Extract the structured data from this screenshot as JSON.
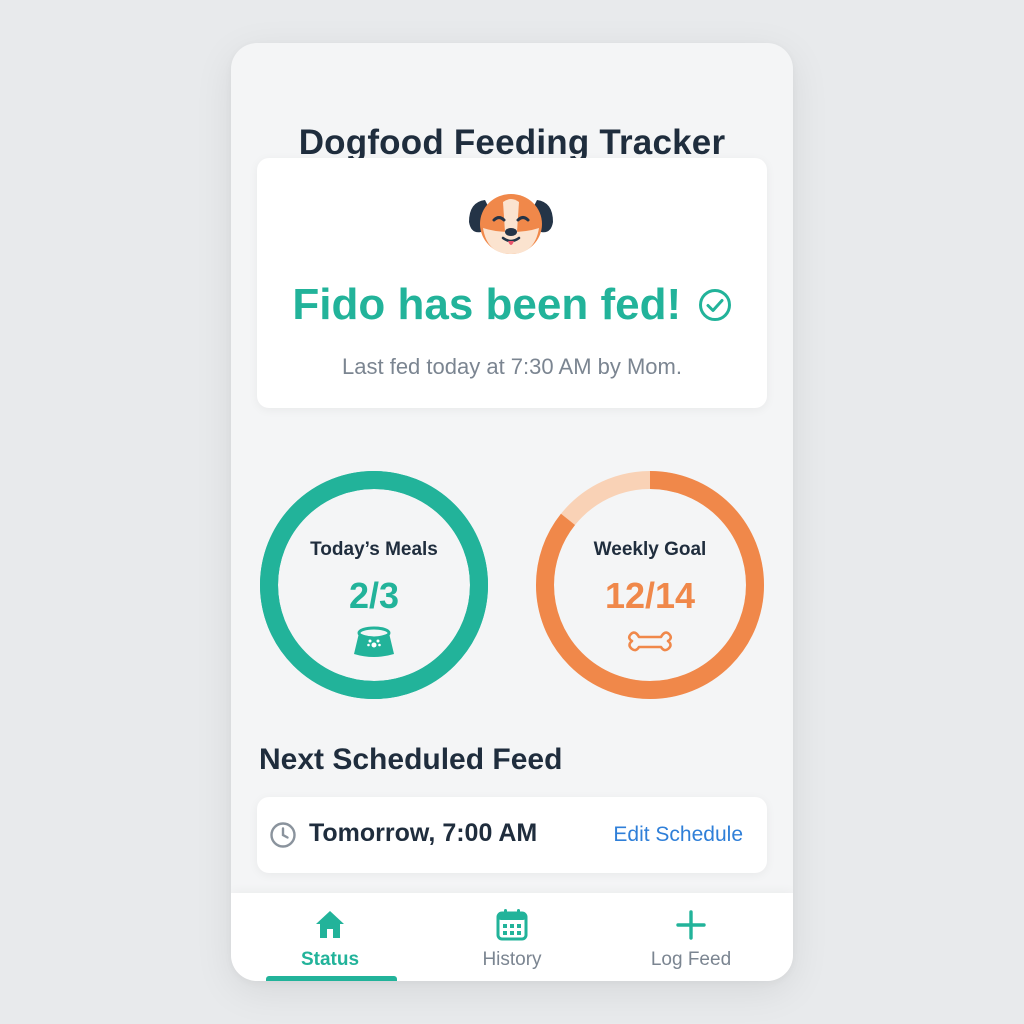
{
  "app": {
    "title": "Dogfood Feeding Tracker"
  },
  "status_card": {
    "avatar_icon": "dog-face-icon",
    "message": "Fido has been fed!",
    "status_icon": "check-circle-icon",
    "last_fed": "Last fed today at 7:30 AM by Mom."
  },
  "progress": {
    "meals": {
      "label": "Today’s Meals",
      "value_text": "2/3",
      "fraction": 1.0,
      "icon": "food-bowl-icon",
      "color": "#22b39a"
    },
    "weekly": {
      "label": "Weekly Goal",
      "value_text": "12/14",
      "fraction": 0.857,
      "icon": "bone-icon",
      "color": "#f0884a",
      "track_color": "#f9d2b6"
    }
  },
  "next_feed": {
    "section_title": "Next Scheduled Feed",
    "icon": "clock-icon",
    "time": "Tomorrow, 7:00 AM",
    "edit_label": "Edit Schedule"
  },
  "nav": {
    "items": [
      {
        "label": "Status",
        "icon": "home-icon",
        "active": true
      },
      {
        "label": "History",
        "icon": "calendar-icon",
        "active": false
      },
      {
        "label": "Log Feed",
        "icon": "plus-icon",
        "active": false
      }
    ]
  },
  "colors": {
    "accent": "#22b39a",
    "secondary": "#f0884a",
    "link": "#2f7fd8",
    "text_dark": "#1f2d3d",
    "text_muted": "#7b8591"
  }
}
